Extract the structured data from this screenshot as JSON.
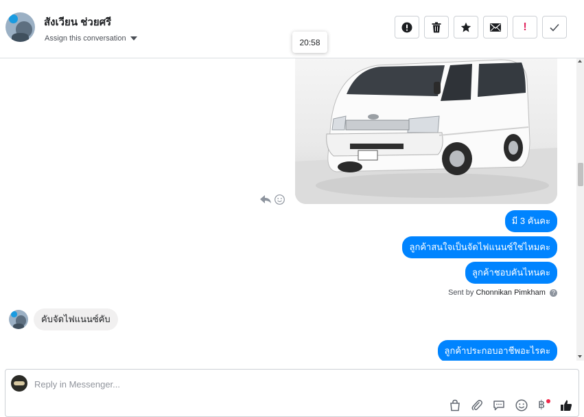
{
  "header": {
    "contact_name": "สังเวียน ช่วยศรี",
    "assign_label": "Assign this conversation",
    "tooltip_time": "20:58"
  },
  "toolbar": {
    "buttons": [
      "spam-alert",
      "delete",
      "star",
      "email",
      "mark-important",
      "done"
    ],
    "important_glyph": "!"
  },
  "messages": {
    "outgoing": [
      "มี 3 คันคะ",
      "ลูกค้าสนใจเป็นจัดไฟแนนซ์ใช่ไหมคะ",
      "ลูกค้าชอบคันไหนคะ"
    ],
    "sent_by_prefix": "Sent by",
    "sent_by_name": "Chonnikan Pimkham",
    "help_glyph": "?",
    "incoming": "คับจัดไฟแนนซ์คับ",
    "outgoing_last": "ลูกค้าประกอบอาชีพอะไรคะ"
  },
  "composer": {
    "placeholder": "Reply in Messenger...",
    "baht_glyph": "฿"
  },
  "colors": {
    "accent": "#0084ff",
    "incoming_bubble": "#f1f0f0",
    "border": "#ccd0d5",
    "text": "#1c1e21",
    "icon": "#606770",
    "notification_dot": "#f02849",
    "important_red": "#e0245e"
  }
}
